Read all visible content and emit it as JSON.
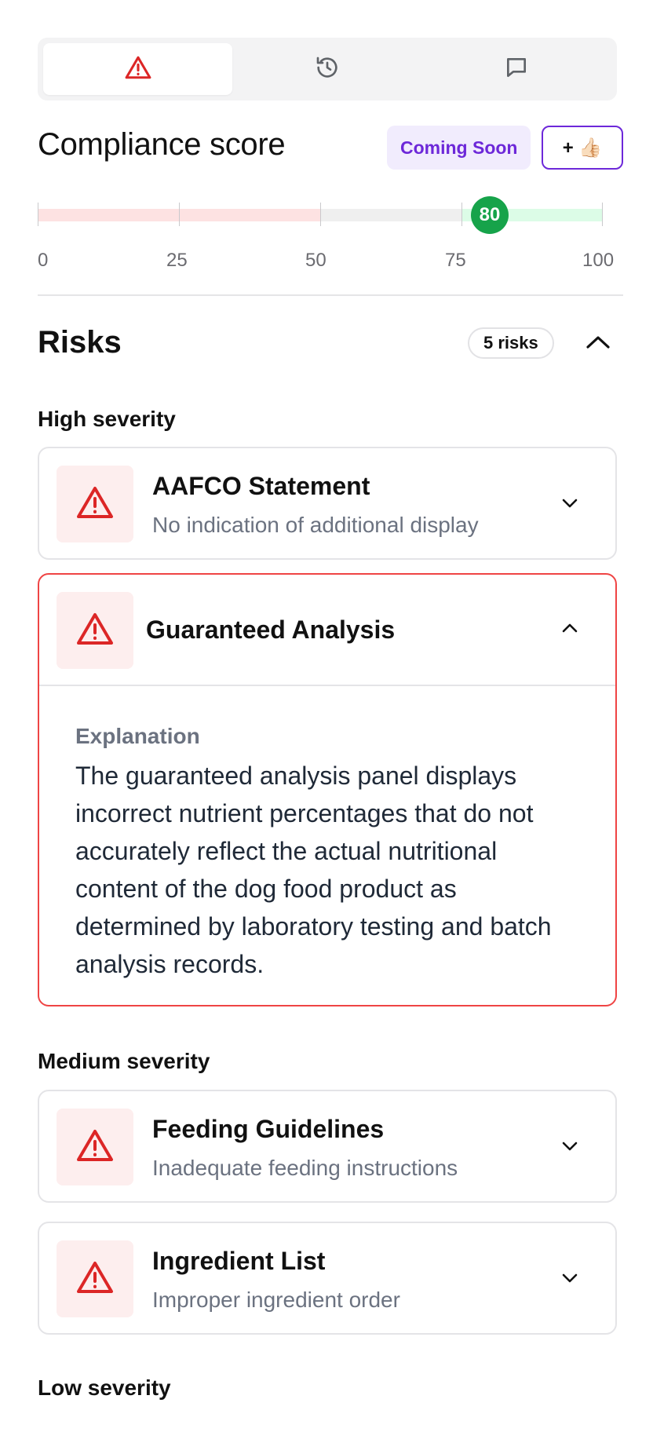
{
  "tabs": [
    {
      "icon": "warning-triangle-icon",
      "active": true
    },
    {
      "icon": "history-icon",
      "active": false
    },
    {
      "icon": "message-icon",
      "active": false
    }
  ],
  "compliance": {
    "title": "Compliance score",
    "coming_soon_label": "Coming Soon",
    "like_label": "+ 👍🏻",
    "score": 80,
    "score_label": "80",
    "scale_ticks": [
      "0",
      "25",
      "50",
      "75",
      "100"
    ],
    "colors": {
      "low": "#fde2e2",
      "mid": "#efefef",
      "high": "#dcfce7",
      "marker": "#16a34a"
    }
  },
  "risks": {
    "title": "Risks",
    "count_label": "5 risks",
    "groups": [
      {
        "label": "High severity",
        "items": [
          {
            "title": "AAFCO Statement",
            "subtitle": "No indication of additional display"
          },
          {
            "title": "Guaranteed Analysis",
            "expanded": true,
            "explanation_label": "Explanation",
            "explanation": "The guaranteed analysis panel displays incorrect nutrient percentages that do not accurately reflect the actual nutritional content of the dog food product as determined by laboratory testing and batch analysis records."
          }
        ]
      },
      {
        "label": "Medium severity",
        "items": [
          {
            "title": "Feeding Guidelines",
            "subtitle": "Inadequate feeding instructions"
          },
          {
            "title": "Ingredient List",
            "subtitle": "Improper ingredient order"
          }
        ]
      },
      {
        "label": "Low severity",
        "items": []
      }
    ]
  },
  "accent_color": "#dc2626"
}
